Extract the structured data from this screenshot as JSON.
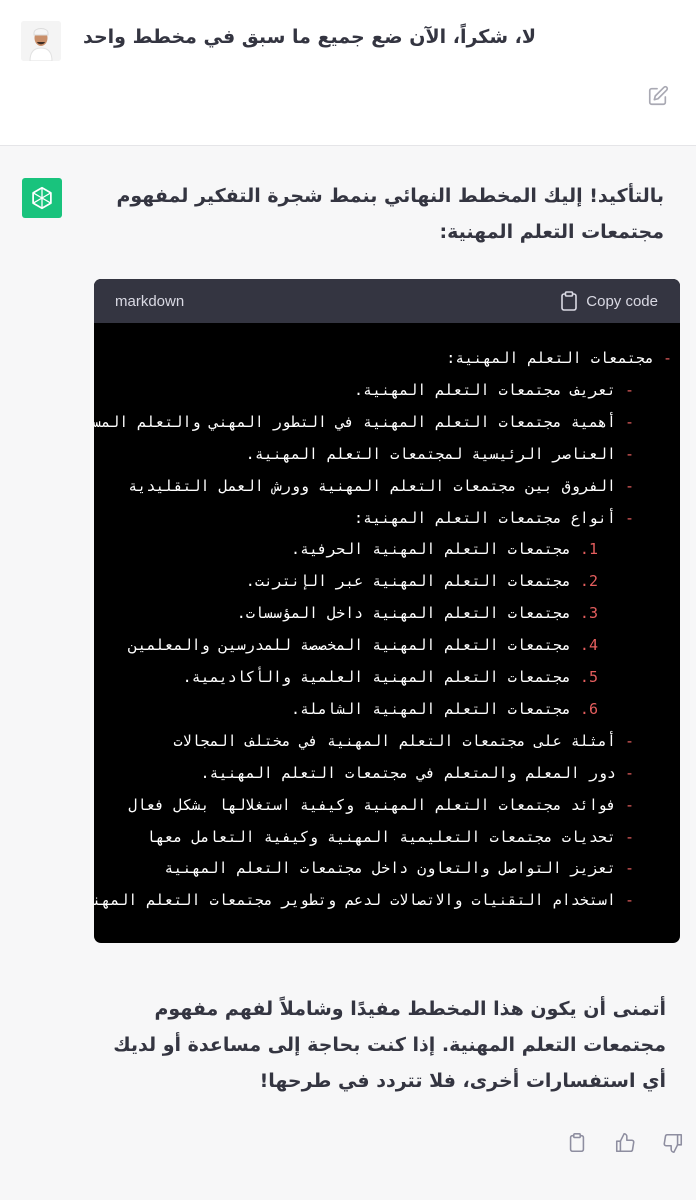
{
  "user": {
    "message": "لا، شكراً، الآن ضع جميع ما سبق في مخطط واحد",
    "avatar_icon": "user-avatar",
    "edit_icon": "edit-icon"
  },
  "assistant": {
    "avatar_icon": "openai-logo-icon",
    "intro": "بالتأكيد! إليك المخطط النهائي بنمط شجرة التفكير لمفهوم مجتمعات التعلم المهنية:",
    "code": {
      "language": "markdown",
      "copy_label": "Copy code",
      "lines": [
        {
          "marker": "-",
          "text": "مجتمعات التعلم المهنية:"
        },
        {
          "marker": "-",
          "text": "تعريف مجتمعات التعلم المهنية."
        },
        {
          "marker": "-",
          "text": "أهمية مجتمعات التعلم المهنية في التطور المهني والتعلم المستمر"
        },
        {
          "marker": "-",
          "text": "العناصر الرئيسية لمجتمعات التعلم المهنية."
        },
        {
          "marker": "-",
          "text": "الفروق بين مجتمعات التعلم المهنية وورش العمل التقليدية"
        },
        {
          "marker": "-",
          "text": "أنواع مجتمعات التعلم المهنية:"
        },
        {
          "marker": "1.",
          "text": "مجتمعات التعلم المهنية الحرفية."
        },
        {
          "marker": "2.",
          "text": "مجتمعات التعلم المهنية عبر الإنترنت."
        },
        {
          "marker": "3.",
          "text": "مجتمعات التعلم المهنية داخل المؤسسات."
        },
        {
          "marker": "4.",
          "text": "مجتمعات التعلم المهنية المخصصة للمدرسين والمعلمين"
        },
        {
          "marker": "5.",
          "text": "مجتمعات التعلم المهنية العلمية والأكاديمية."
        },
        {
          "marker": "6.",
          "text": "مجتمعات التعلم المهنية الشاملة."
        },
        {
          "marker": "-",
          "text": "أمثلة على مجتمعات التعلم المهنية في مختلف المجالات"
        },
        {
          "marker": "-",
          "text": "دور المعلم والمتعلم في مجتمعات التعلم المهنية."
        },
        {
          "marker": "-",
          "text": "فوائد مجتمعات التعلم المهنية وكيفية استغلالها بشكل فعال"
        },
        {
          "marker": "-",
          "text": "تحديات مجتمعات التعليمية المهنية وكيفية التعامل معها"
        },
        {
          "marker": "-",
          "text": "تعزيز التواصل والتعاون داخل مجتمعات التعلم المهنية"
        },
        {
          "marker": "-",
          "text": "استخدام التقنيات والاتصالات لدعم وتطوير مجتمعات التعلم المهنية"
        }
      ]
    },
    "outro": "أتمنى أن يكون هذا المخطط مفيدًا وشاملاً لفهم مفهوم مجتمعات التعلم المهنية. إذا كنت بحاجة إلى مساعدة أو لديك أي استفسارات أخرى، فلا تتردد في طرحها!",
    "actions": [
      "clipboard-icon",
      "thumbs-up-icon",
      "thumbs-down-icon"
    ]
  },
  "colors": {
    "accent": "#19c37d",
    "code_bg": "#000000",
    "code_header_bg": "#343541",
    "list_marker": "#e55e5e",
    "assistant_bg": "#f7f7f8"
  }
}
